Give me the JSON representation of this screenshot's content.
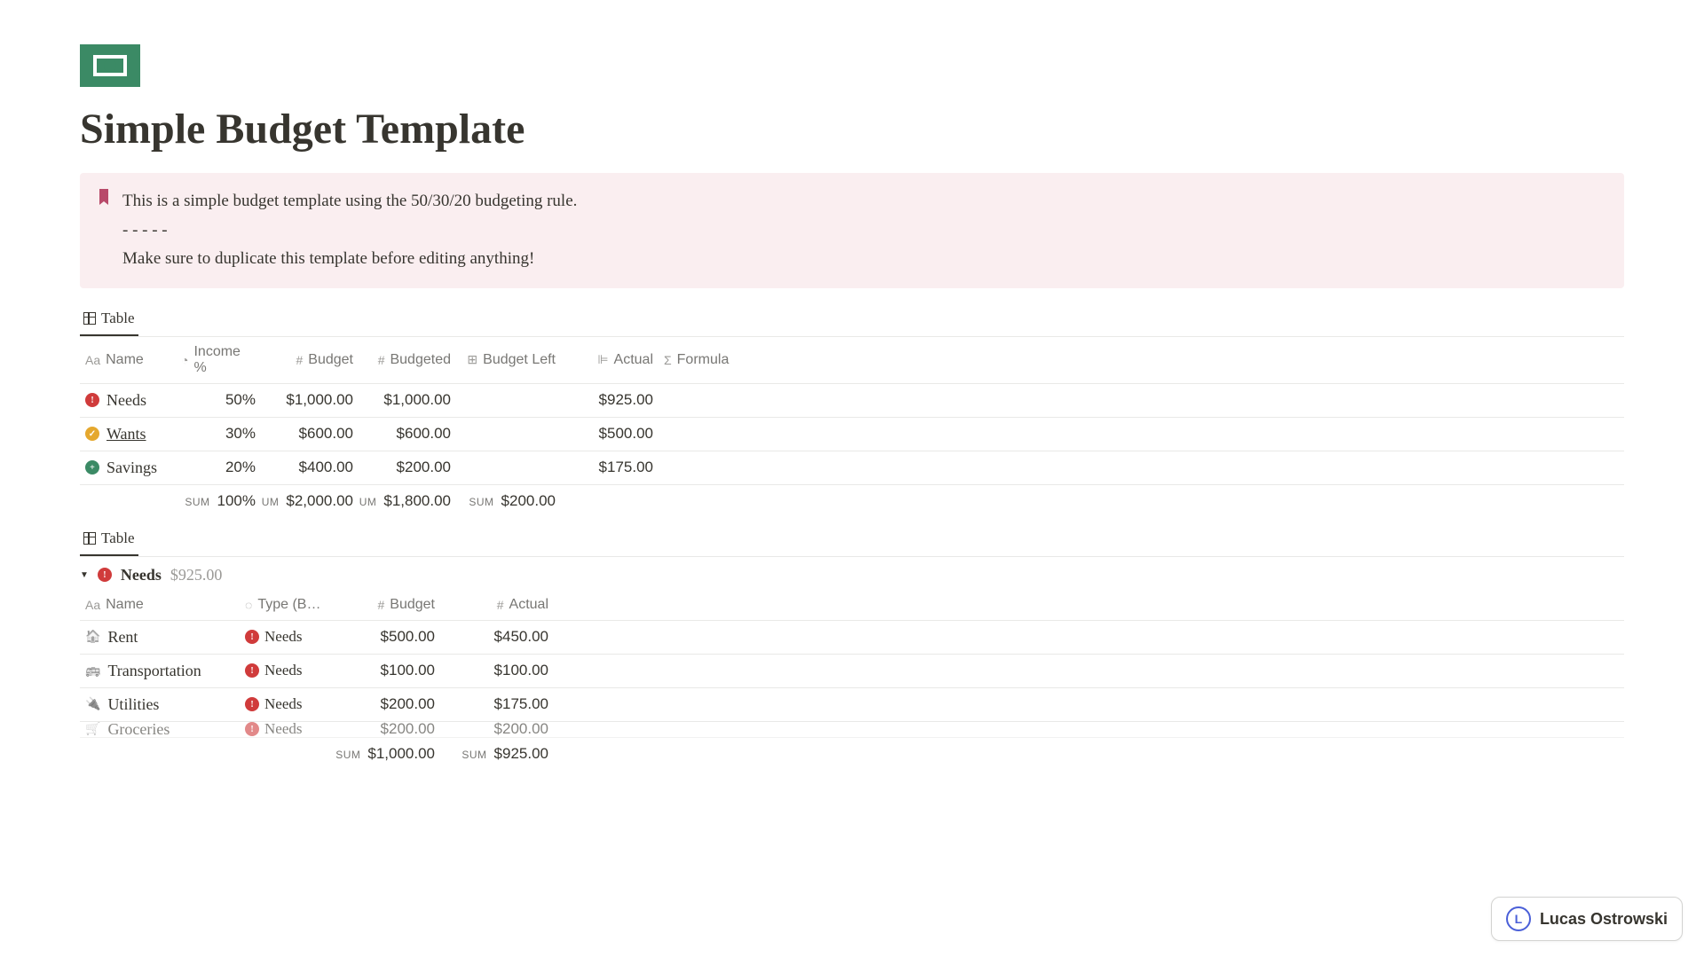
{
  "page": {
    "title": "Simple Budget Template",
    "callout": {
      "line1": "This is a simple budget template using the 50/30/20 budgeting rule.",
      "dashes": "- - - - -",
      "line2": "Make sure to duplicate this template before editing anything!"
    }
  },
  "table1": {
    "tab_label": "Table",
    "headers": {
      "name": "Name",
      "income": "Income %",
      "budget": "Budget",
      "budgeted": "Budgeted",
      "budget_left": "Budget Left",
      "actual": "Actual",
      "formula": "Formula"
    },
    "rows": [
      {
        "icon": "red",
        "glyph": "!",
        "name": "Needs",
        "income": "50%",
        "budget": "$1,000.00",
        "budgeted": "$1,000.00",
        "actual": "$925.00"
      },
      {
        "icon": "yellow",
        "glyph": "✓",
        "name": "Wants",
        "underline": true,
        "income": "30%",
        "budget": "$600.00",
        "budgeted": "$600.00",
        "actual": "$500.00"
      },
      {
        "icon": "green",
        "glyph": "+",
        "name": "Savings",
        "income": "20%",
        "budget": "$400.00",
        "budgeted": "$200.00",
        "actual": "$175.00"
      }
    ],
    "sums": {
      "label": "SUM",
      "income": "100%",
      "budget": "$2,000.00",
      "budgeted": "$1,800.00",
      "budget_left": "$200.00"
    }
  },
  "table2": {
    "tab_label": "Table",
    "group": {
      "name": "Needs",
      "amount": "$925.00"
    },
    "headers": {
      "name": "Name",
      "type": "Type (B…",
      "budget": "Budget",
      "actual": "Actual"
    },
    "rows": [
      {
        "icon_name": "home-icon",
        "name": "Rent",
        "type": "Needs",
        "budget": "$500.00",
        "actual": "$450.00"
      },
      {
        "icon_name": "bus-icon",
        "name": "Transportation",
        "type": "Needs",
        "budget": "$100.00",
        "actual": "$100.00"
      },
      {
        "icon_name": "plug-icon",
        "name": "Utilities",
        "type": "Needs",
        "budget": "$200.00",
        "actual": "$175.00"
      },
      {
        "icon_name": "cart-icon",
        "name": "Groceries",
        "type": "Needs",
        "budget": "$200.00",
        "actual": "$200.00"
      }
    ],
    "sums": {
      "label": "SUM",
      "budget": "$1,000.00",
      "actual": "$925.00"
    }
  },
  "user_badge": {
    "name": "Lucas Ostrowski",
    "initial": "L"
  }
}
